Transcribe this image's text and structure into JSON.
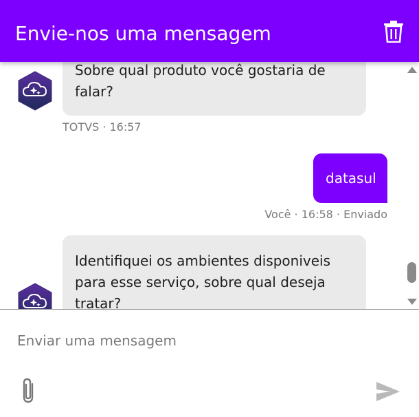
{
  "header": {
    "title": "Envie-nos uma mensagem",
    "icon": "trash-icon"
  },
  "messages": [
    {
      "from": "bot",
      "lines": [
        "Sobre qual produto você gostaria de",
        "falar?"
      ],
      "meta": "TOTVS · 16:57"
    },
    {
      "from": "user",
      "lines": [
        "datasul"
      ],
      "meta": "Você · 16:58 · Enviado"
    },
    {
      "from": "bot",
      "lines": [
        "Identifiquei os ambientes disponiveis",
        "para esse serviço, sobre qual deseja",
        "tratar?"
      ]
    }
  ],
  "composer": {
    "placeholder": "Enviar uma mensagem",
    "value": ""
  },
  "colors": {
    "brand": "#7d00ff",
    "bot_bubble": "#eaeaea",
    "meta_text": "#7a7a7a"
  }
}
